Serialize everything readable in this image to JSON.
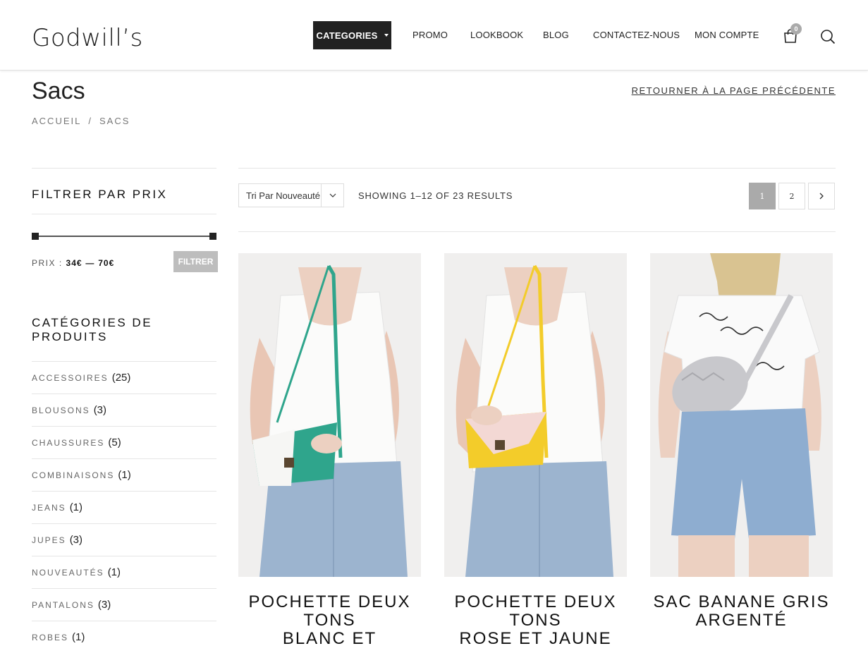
{
  "header": {
    "logo": "Godwill’s",
    "nav": [
      {
        "label": "CATEGORIES"
      },
      {
        "label": "PROMO"
      },
      {
        "label": "LOOKBOOK"
      },
      {
        "label": "BLOG"
      },
      {
        "label": "CONTACTEZ-NOUS"
      },
      {
        "label": "MON COMPTE"
      }
    ],
    "cart_count": "0",
    "icons": {
      "cart": "shopping-bag-icon",
      "search": "search-icon"
    }
  },
  "page": {
    "title": "Sacs",
    "back_link": "RETOURNER À LA PAGE PRÉCÉDENTE",
    "breadcrumb": {
      "home": "ACCUEIL",
      "separator": "/",
      "current": "SACS"
    }
  },
  "sidebar": {
    "price_filter": {
      "title": "FILTRER PAR PRIX",
      "label": "PRIX :",
      "min": "34€",
      "dash": "—",
      "max": "70€",
      "button": "FILTRER"
    },
    "categories": {
      "title": "CATÉGORIES DE PRODUITS",
      "items": [
        {
          "name": "ACCESSOIRES",
          "count": "(25)"
        },
        {
          "name": "BLOUSONS",
          "count": "(3)"
        },
        {
          "name": "CHAUSSURES",
          "count": "(5)"
        },
        {
          "name": "COMBINAISONS",
          "count": "(1)"
        },
        {
          "name": "JEANS",
          "count": "(1)"
        },
        {
          "name": "JUPES",
          "count": "(3)"
        },
        {
          "name": "NOUVEAUTÉS",
          "count": "(1)"
        },
        {
          "name": "PANTALONS",
          "count": "(3)"
        },
        {
          "name": "ROBES",
          "count": "(1)"
        }
      ]
    }
  },
  "toolbar": {
    "sort_value": "Tri Par Nouveauté",
    "results": "SHOWING 1–12 OF 23 RESULTS",
    "pages": [
      "1",
      "2"
    ],
    "next": "›"
  },
  "products": [
    {
      "name_line1": "POCHETTE DEUX TONS",
      "name_line2": "BLANC ET TURQUOISE",
      "bag_color": "#2fa58c",
      "bag_color2": "#f4f4f2"
    },
    {
      "name_line1": "POCHETTE DEUX TONS",
      "name_line2": "ROSE ET JAUNE",
      "bag_color": "#f3cc2a",
      "bag_color2": "#f3d8d4"
    },
    {
      "name_line1": "SAC BANANE GRIS",
      "name_line2": "ARGENTÉ",
      "bag_color": "#c8c8cc",
      "bag_color2": "#e6e6e8"
    }
  ],
  "colors": {
    "accent_dark": "#222222",
    "active_page": "#aaaaaa",
    "filter_button": "#bdbdbd"
  }
}
